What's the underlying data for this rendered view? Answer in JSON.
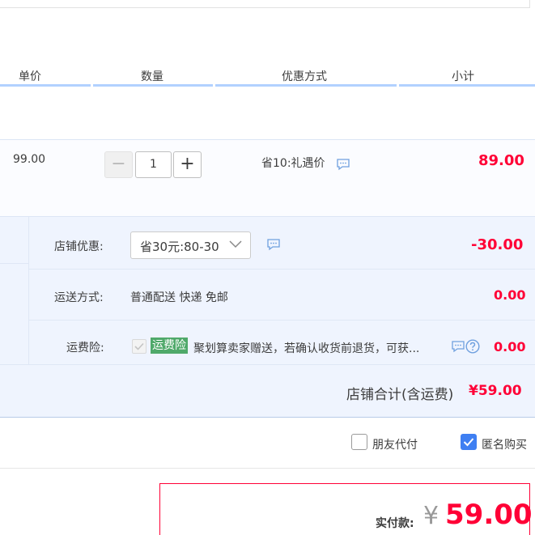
{
  "header": {
    "columns": [
      "单价",
      "数量",
      "优惠方式",
      "小计"
    ]
  },
  "item": {
    "unit_price": "99.00",
    "quantity": "1",
    "minus": "−",
    "plus": "+",
    "discount": "省10:礼遇价",
    "subtotal": "89.00"
  },
  "shop": {
    "coupon_label": "店铺优惠:",
    "coupon_value": "省30元:80-30",
    "coupon_amount": "-30.00",
    "shipping_label": "运送方式:",
    "shipping_value": "普通配送 快递 免邮",
    "shipping_amount": "0.00",
    "insurance_label": "运费险:",
    "insurance_tag": "运费险",
    "insurance_text": "聚划算卖家赠送，若确认收货前退货，可获...",
    "insurance_amount": "0.00",
    "total_label": "店铺合计(含运费)",
    "total_value": "¥59.00"
  },
  "options": {
    "friend_pay": "朋友代付",
    "anonymous": "匿名购买"
  },
  "payment": {
    "label": "实付款:",
    "currency": "¥",
    "amount": "59.00"
  },
  "colors": {
    "accent_red": "#ff0036",
    "check_blue": "#3f7ff2",
    "tag_green": "#4fa96a",
    "icon_blue": "#6fa0df"
  }
}
